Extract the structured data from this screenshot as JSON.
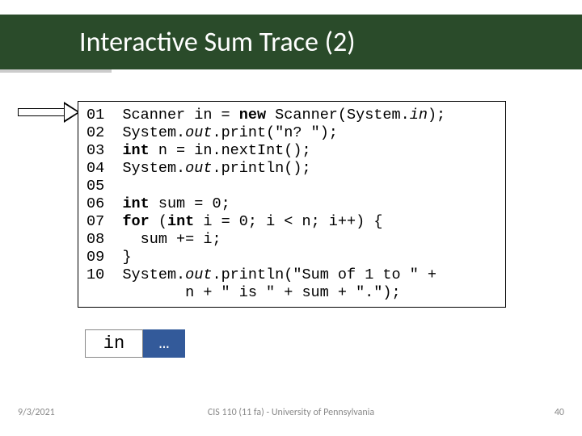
{
  "slide": {
    "title": "Interactive Sum Trace (2)"
  },
  "code": {
    "l01_num": "01",
    "l01_a": "Scanner in = ",
    "l01_new": "new",
    "l01_b": " Scanner(System.",
    "l01_in": "in",
    "l01_c": ");",
    "l02_num": "02",
    "l02_a": "System.",
    "l02_out": "out",
    "l02_b": ".print(\"n? \");",
    "l03_num": "03",
    "l03_a": "",
    "l03_int": "int",
    "l03_b": " n = in.nextInt();",
    "l04_num": "04",
    "l04_a": "System.",
    "l04_out": "out",
    "l04_b": ".println();",
    "l05_num": "05",
    "l06_num": "06",
    "l06_int": "int",
    "l06_b": " sum = 0;",
    "l07_num": "07",
    "l07_for": "for",
    "l07_a": " (",
    "l07_int": "int",
    "l07_b": " i = 0; i < n; i++) {",
    "l08_num": "08",
    "l08_b": "  sum += i;",
    "l09_num": "09",
    "l09_b": "}",
    "l10_num": "10",
    "l10_a": "System.",
    "l10_out": "out",
    "l10_b": ".println(\"Sum of 1 to \" +",
    "l11_b": "       n + \" is \" + sum + \".\");"
  },
  "vars": {
    "in_label": "in",
    "in_val": "…"
  },
  "footer": {
    "date": "9/3/2021",
    "center": "CIS 110 (11 fa) - University of Pennsylvania",
    "page": "40"
  }
}
